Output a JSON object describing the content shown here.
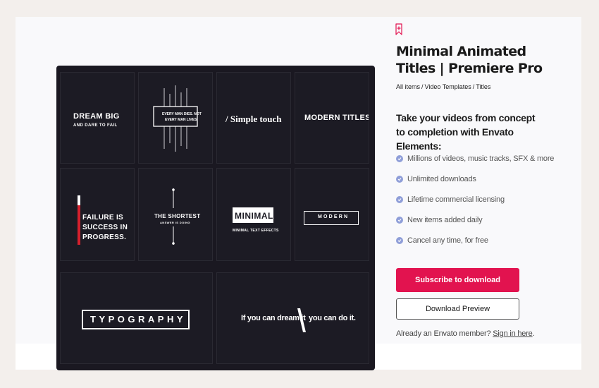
{
  "product": {
    "title": "Minimal Animated Titles | Premiere Pro",
    "breadcrumb": [
      "All items",
      "Video Templates",
      "Titles"
    ]
  },
  "preview_tiles": {
    "dream_big": "DREAM BIG",
    "dream_big_sub": "AND DARE TO FAIL",
    "quote_1": "EVERY MAN DIES. NOT",
    "quote_2": "EVERY MAN LIVES.",
    "simple_touch": "/ Simple touch",
    "modern_titles": "MODERN TITLES",
    "failure_1": "FAILURE IS",
    "failure_2": "SUCCESS IN",
    "failure_3": "PROGRESS.",
    "shortest": "THE SHORTEST",
    "shortest_sub": "ANSWER IS DOING",
    "minimal": "MINIMAL",
    "minimal_sub": "MINIMAL TEXT EFFECTS",
    "modern": "MODERN",
    "typography": "TYPOGRAPHY",
    "dream_left": "If you can dream it",
    "dream_right": "you can do it."
  },
  "promo": {
    "heading": "Take your videos from concept to completion with Envato Elements:",
    "features": [
      "Millions of videos, music tracks, SFX & more",
      "Unlimited downloads",
      "Lifetime commercial licensing",
      "New items added daily",
      "Cancel any time, for free"
    ]
  },
  "actions": {
    "subscribe_label": "Subscribe to download",
    "preview_label": "Download Preview",
    "member_text": "Already an Envato member?",
    "sign_in": "Sign in here",
    "member_end": "."
  },
  "colors": {
    "accent": "#e2134f",
    "check": "#8f9ed8",
    "preview_bg": "#1a1821"
  }
}
